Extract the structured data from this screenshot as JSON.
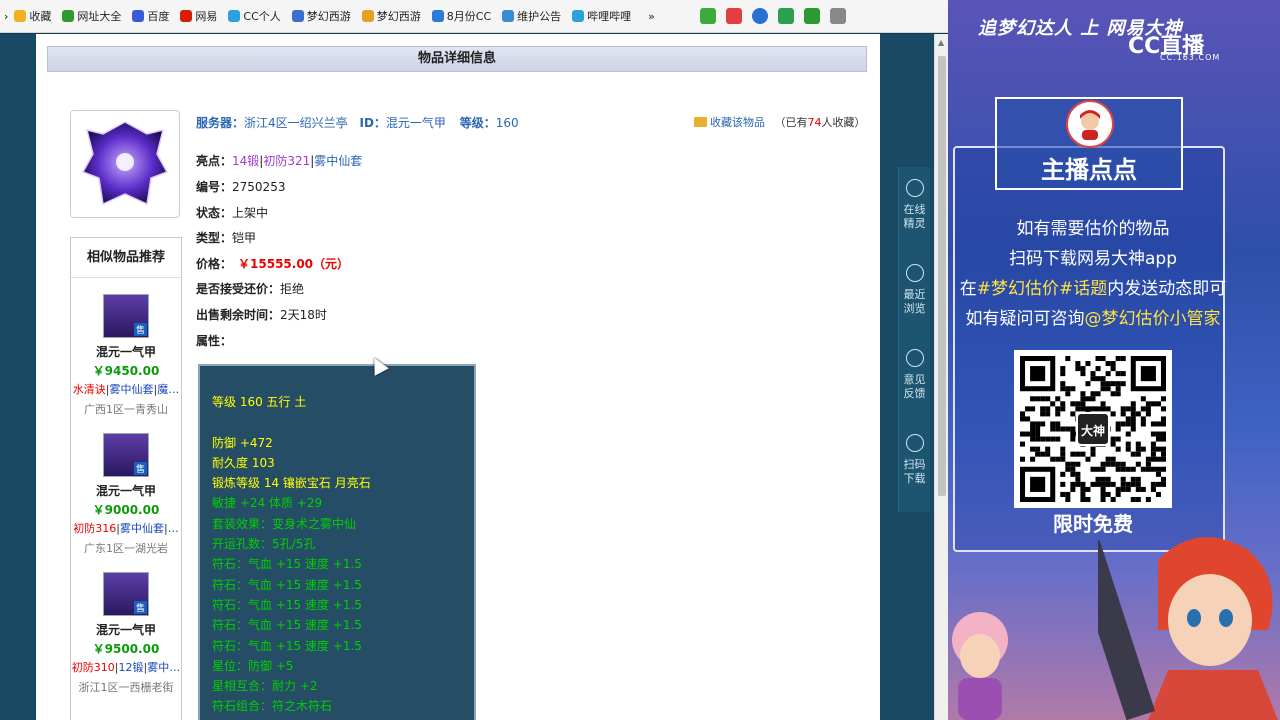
{
  "bookmarks": {
    "back_glyph": "›",
    "items": [
      {
        "label": "收藏",
        "icon": "star-icon",
        "color": "#f2b01e"
      },
      {
        "label": "网址大全",
        "icon": "globe-icon",
        "color": "#2e9a2e"
      },
      {
        "label": "百度",
        "icon": "paw-icon",
        "color": "#3a5bd9"
      },
      {
        "label": "网易",
        "icon": "netease-icon",
        "color": "#d81e06"
      },
      {
        "label": "CC个人",
        "icon": "cc-icon",
        "color": "#2ea0e0"
      },
      {
        "label": "梦幻西游",
        "icon": "game-icon",
        "color": "#3a6fd0"
      },
      {
        "label": "梦幻西游",
        "icon": "game-icon",
        "color": "#e8a020"
      },
      {
        "label": "8月份CC",
        "icon": "cc-icon",
        "color": "#2e7ad9"
      },
      {
        "label": "维护公告",
        "icon": "notice-icon",
        "color": "#3a8ad9"
      },
      {
        "label": "哔哩哔哩",
        "icon": "bilibili-icon",
        "color": "#2aa3d8"
      }
    ],
    "more_glyph": "»"
  },
  "detail": {
    "header": "物品详细信息",
    "server_label": "服务器：",
    "server_value": "浙江4区一绍兴兰亭",
    "id_label": "ID：",
    "id_value": "混元一气甲",
    "level_label": "等级：",
    "level_value": "160",
    "favorite_label": "收藏该物品",
    "favorite_count_prefix": "（已有",
    "favorite_count": "74",
    "favorite_count_suffix": "人收藏）",
    "highlight_label": "亮点：",
    "highlight_1": "14锻",
    "highlight_2": "初防321",
    "highlight_3": "雾中仙套",
    "sep": "|",
    "number_label": "编号：",
    "number_value": "2750253",
    "status_label": "状态：",
    "status_value": "上架中",
    "type_label": "类型：",
    "type_value": "铠甲",
    "price_label": "价格：",
    "price_value": "￥15555.00（元）",
    "bargain_label": "是否接受还价：",
    "bargain_value": "拒绝",
    "remaining_label": "出售剩余时间：",
    "remaining_value": "2天18时",
    "attributes_label": "属性："
  },
  "attributes": [
    {
      "text": "等级 160 五行 土",
      "color": "yellow"
    },
    {
      "text": "",
      "color": "yellow"
    },
    {
      "text": "防御 +472",
      "color": "yellow"
    },
    {
      "text": "耐久度 103",
      "color": "yellow"
    },
    {
      "text": "锻炼等级 14 镶嵌宝石 月亮石",
      "color": "yellow"
    },
    {
      "text": "敏捷 +24 体质 +29",
      "color": "green"
    },
    {
      "text": "套装效果：变身术之雾中仙",
      "color": "green"
    },
    {
      "text": "开运孔数：5孔/5孔",
      "color": "green"
    },
    {
      "text": "符石：气血 +15 速度 +1.5",
      "color": "green"
    },
    {
      "text": "符石：气血 +15 速度 +1.5",
      "color": "green"
    },
    {
      "text": "符石：气血 +15 速度 +1.5",
      "color": "green"
    },
    {
      "text": "符石：气血 +15 速度 +1.5",
      "color": "green"
    },
    {
      "text": "符石：气血 +15 速度 +1.5",
      "color": "green"
    },
    {
      "text": "星位：防御 +5",
      "color": "green"
    },
    {
      "text": "星相互合：耐力 +2",
      "color": "green"
    },
    {
      "text": "符石组合：符之木符石",
      "color": "green"
    }
  ],
  "similar": {
    "title": "相似物品推荐",
    "sale_tag": "售",
    "items": [
      {
        "name": "混元一气甲",
        "price": "￥9450.00",
        "tag1": "水清诀",
        "tag2": "雾中仙套",
        "tag3": "魔…",
        "server": "广西1区一青秀山"
      },
      {
        "name": "混元一气甲",
        "price": "￥9000.00",
        "tag1": "初防316",
        "tag2": "雾中仙套",
        "tag3": "…",
        "server": "广东1区一湖光岩"
      },
      {
        "name": "混元一气甲",
        "price": "￥9500.00",
        "tag1": "初防310",
        "tag2": "12锻",
        "tag3": "雾中…",
        "server": "浙江1区一西栅老街"
      }
    ]
  },
  "side_tools": [
    {
      "label": "在线精灵",
      "icon": "sprite-icon"
    },
    {
      "label": "最近浏览",
      "icon": "clock-icon"
    },
    {
      "label": "意见反馈",
      "icon": "feedback-icon"
    },
    {
      "label": "扫码下载",
      "icon": "scan-icon"
    }
  ],
  "overlay": {
    "title": "追梦幻达人 上 网易大神",
    "cc_logo": "CC直播",
    "cc_sub": "CC.163.COM",
    "host_name": "主播点点",
    "line1": "如有需要估价的物品",
    "line2": "扫码下载网易大神app",
    "line3_prefix": "在",
    "line3_hl": "#梦幻估价#话题",
    "line3_suffix": "内发送动态即可",
    "line4_prefix": "如有疑问可咨询",
    "line4_hl": "@梦幻估价小管家",
    "qr_badge": "大神",
    "free_label": "限时免费"
  }
}
